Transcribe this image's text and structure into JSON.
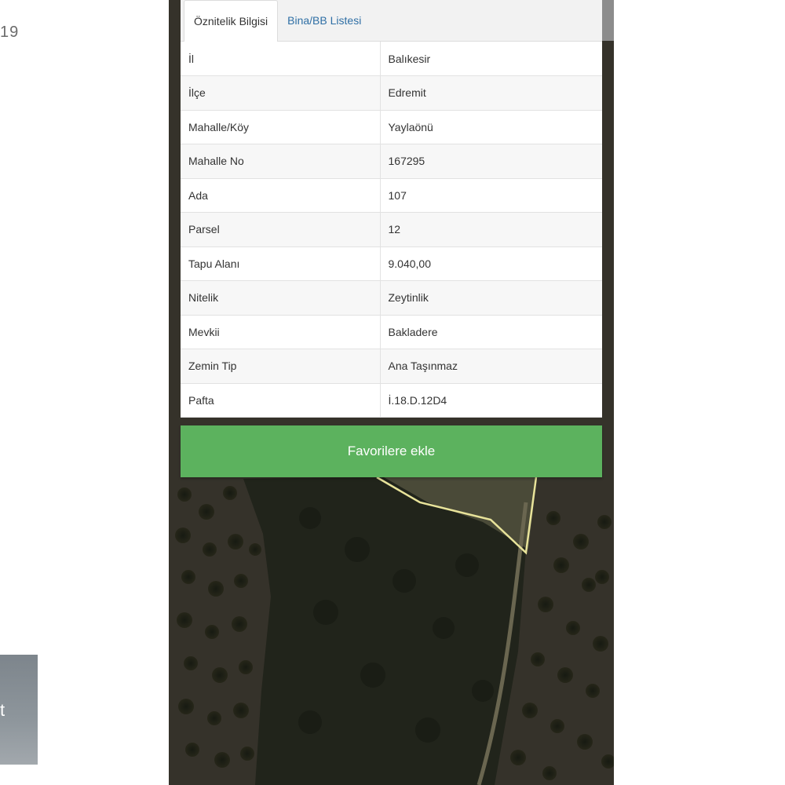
{
  "background": {
    "partial_number": "19",
    "side_card_text": "t"
  },
  "panel": {
    "tabs": [
      {
        "label": "Öznitelik Bilgisi",
        "active": true
      },
      {
        "label": "Bina/BB Listesi",
        "active": false
      }
    ],
    "rows": [
      {
        "key": "İl",
        "value": "Balıkesir"
      },
      {
        "key": "İlçe",
        "value": "Edremit"
      },
      {
        "key": "Mahalle/Köy",
        "value": "Yaylaönü"
      },
      {
        "key": "Mahalle No",
        "value": "167295"
      },
      {
        "key": "Ada",
        "value": "107"
      },
      {
        "key": "Parsel",
        "value": "12"
      },
      {
        "key": "Tapu Alanı",
        "value": "9.040,00"
      },
      {
        "key": "Nitelik",
        "value": "Zeytinlik"
      },
      {
        "key": "Mevkii",
        "value": "Bakladere"
      },
      {
        "key": "Zemin Tip",
        "value": "Ana Taşınmaz"
      },
      {
        "key": "Pafta",
        "value": "İ.18.D.12D4"
      }
    ],
    "favorite_button_label": "Favorilere ekle"
  },
  "colors": {
    "button_green": "#5cb25e",
    "tab_link_blue": "#2f6fa5",
    "parcel_outline": "#e8e39a"
  }
}
